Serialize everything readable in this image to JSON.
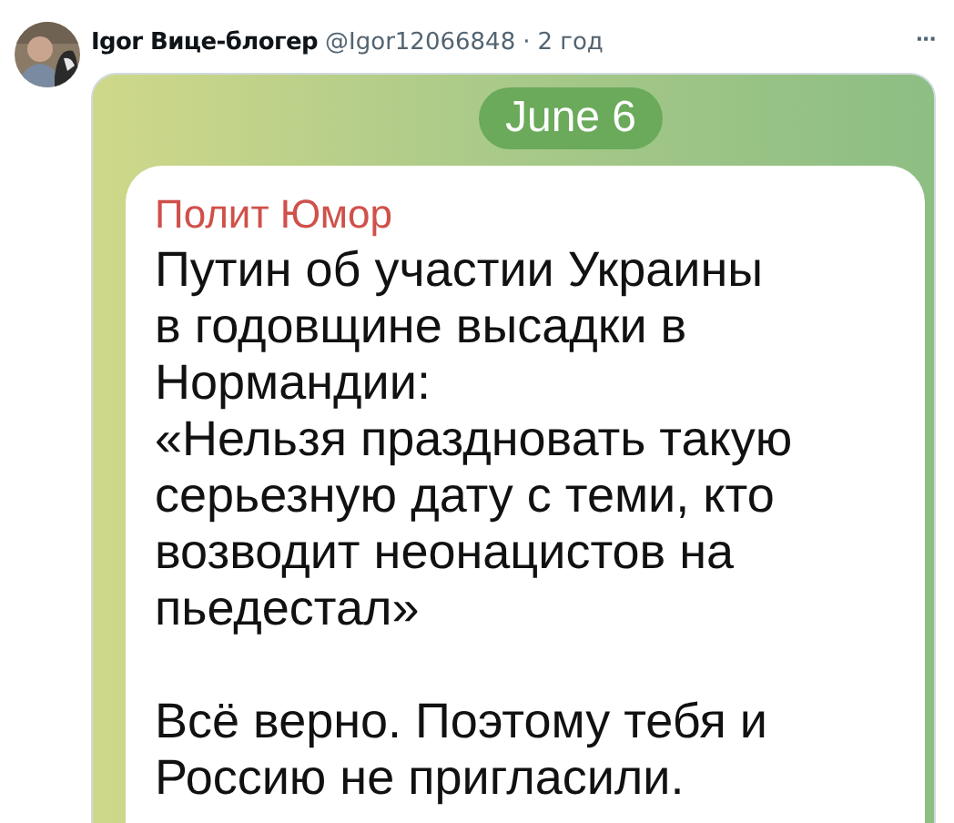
{
  "post": {
    "author": "Igor Вице-блогер",
    "handle": "@Igor12066848",
    "separator": "·",
    "time": "2 год",
    "more": "···"
  },
  "message": {
    "date": "June 6",
    "channel": "Полит Юмор",
    "paragraphs": [
      "Путин об участии Украины\nв годовщине высадки в\nНормандии:\n«Нельзя праздновать такую\nсерьезную дату с теми, кто\nвозводит неонацистов на\nпьедестал»",
      "Всё верно. Поэтому тебя и\nРоссию не пригласили."
    ]
  }
}
